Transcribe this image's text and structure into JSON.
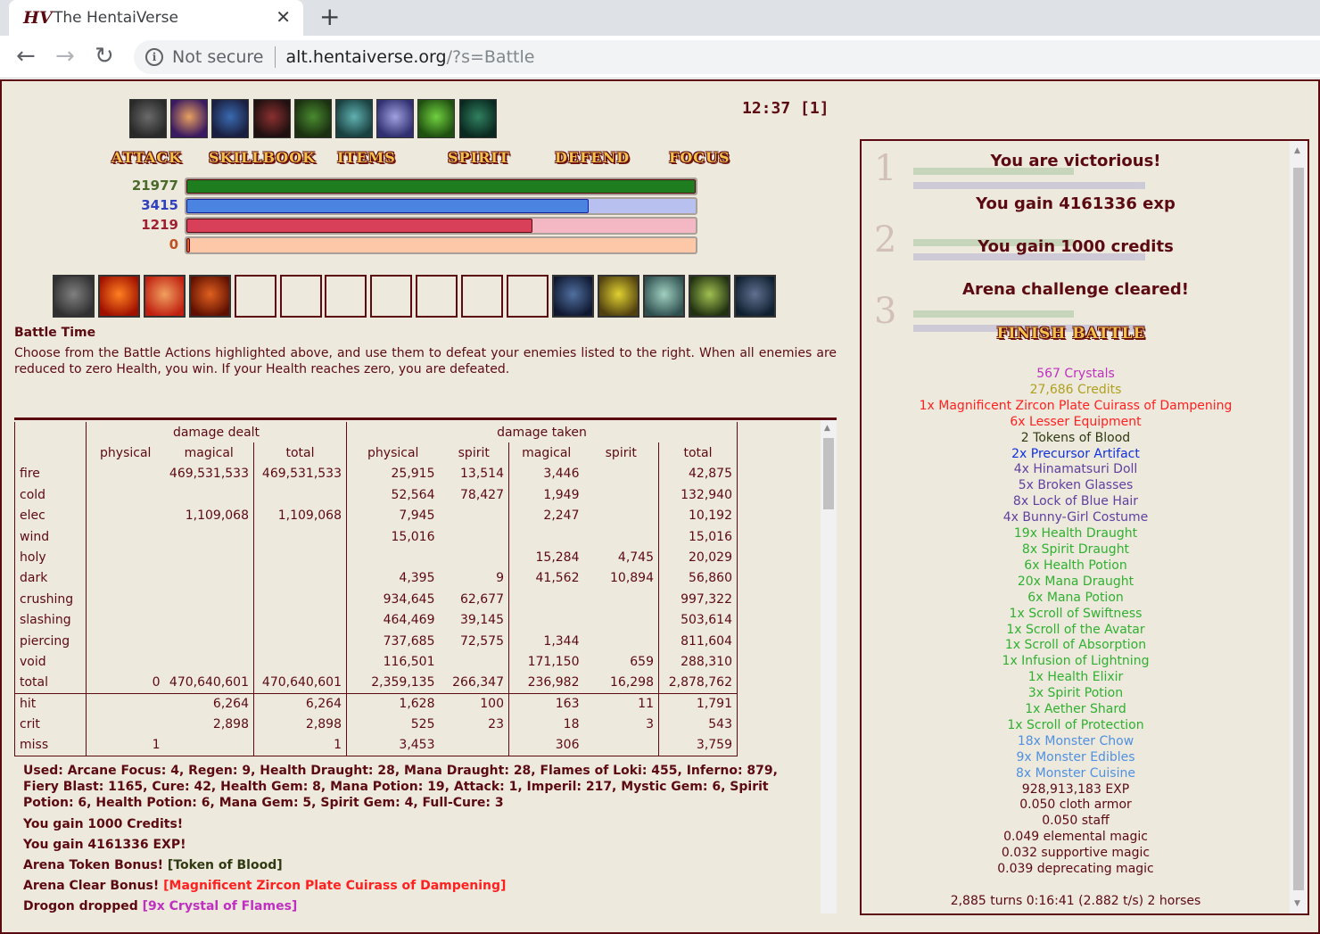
{
  "browser": {
    "tab_title": "The HentaiVerse",
    "favicon_text": "HV",
    "not_secure": "Not secure",
    "url_host": "alt.hentaiverse.org",
    "url_path": "/?s=Battle"
  },
  "timer": "12:37 [1]",
  "menu": {
    "attack": "ATTACK",
    "skillbook": "SKILLBOOK",
    "items": "ITEMS",
    "spirit": "SPIRIT",
    "defend": "DEFEND",
    "focus": "FOCUS"
  },
  "vitals": {
    "health": {
      "value": "21977",
      "fill": 1.0,
      "color": "#1e7d1e"
    },
    "magic": {
      "value": "3415",
      "fill": 0.79,
      "color": "#4a84e0"
    },
    "spirit": {
      "value": "1219",
      "fill": 0.68,
      "color": "#d8405a"
    },
    "overcharge": {
      "value": "0",
      "fill": 0.0,
      "color": "#e06030"
    }
  },
  "battle": {
    "title": "Battle Time",
    "description": "Choose from the Battle Actions highlighted above, and use them to defeat your enemies listed to the right. When all enemies are reduced to zero Health, you win. If your Health reaches zero, you are defeated."
  },
  "stats": {
    "group_dealt": "damage dealt",
    "group_taken": "damage taken",
    "columns": [
      "physical",
      "magical",
      "total",
      "physical",
      "spirit",
      "magical",
      "spirit",
      "total"
    ],
    "rows": [
      {
        "label": "fire",
        "cells": [
          "",
          "469,531,533",
          "469,531,533",
          "25,915",
          "13,514",
          "3,446",
          "",
          "42,875"
        ]
      },
      {
        "label": "cold",
        "cells": [
          "",
          "",
          "",
          "52,564",
          "78,427",
          "1,949",
          "",
          "132,940"
        ]
      },
      {
        "label": "elec",
        "cells": [
          "",
          "1,109,068",
          "1,109,068",
          "7,945",
          "",
          "2,247",
          "",
          "10,192"
        ]
      },
      {
        "label": "wind",
        "cells": [
          "",
          "",
          "",
          "15,016",
          "",
          "",
          "",
          "15,016"
        ]
      },
      {
        "label": "holy",
        "cells": [
          "",
          "",
          "",
          "",
          "",
          "15,284",
          "4,745",
          "20,029"
        ]
      },
      {
        "label": "dark",
        "cells": [
          "",
          "",
          "",
          "4,395",
          "9",
          "41,562",
          "10,894",
          "56,860"
        ]
      },
      {
        "label": "crushing",
        "cells": [
          "",
          "",
          "",
          "934,645",
          "62,677",
          "",
          "",
          "997,322"
        ]
      },
      {
        "label": "slashing",
        "cells": [
          "",
          "",
          "",
          "464,469",
          "39,145",
          "",
          "",
          "503,614"
        ]
      },
      {
        "label": "piercing",
        "cells": [
          "",
          "",
          "",
          "737,685",
          "72,575",
          "1,344",
          "",
          "811,604"
        ]
      },
      {
        "label": "void",
        "cells": [
          "",
          "",
          "",
          "116,501",
          "",
          "171,150",
          "659",
          "288,310"
        ]
      },
      {
        "label": "total",
        "cells": [
          "0",
          "470,640,601",
          "470,640,601",
          "2,359,135",
          "266,347",
          "236,982",
          "16,298",
          "2,878,762"
        ]
      }
    ],
    "rows2": [
      {
        "label": "hit",
        "cells": [
          "",
          "6,264",
          "6,264",
          "1,628",
          "100",
          "163",
          "11",
          "1,791"
        ]
      },
      {
        "label": "crit",
        "cells": [
          "",
          "2,898",
          "2,898",
          "525",
          "23",
          "18",
          "3",
          "543"
        ]
      },
      {
        "label": "miss",
        "cells": [
          "1",
          "",
          "1",
          "3,453",
          "",
          "306",
          "",
          "3,759"
        ]
      }
    ]
  },
  "log": {
    "used": "Used: Arcane Focus: 4, Regen: 9, Health Draught: 28, Mana Draught: 28, Flames of Loki: 455, Inferno: 879, Fiery Blast: 1165, Cure: 42, Health Gem: 8, Mana Potion: 19, Attack: 1, Imperil: 217, Mystic Gem: 6, Spirit Potion: 6, Health Potion: 6, Mana Gem: 5, Spirit Gem: 4, Full-Cure: 3",
    "credits": "You gain 1000 Credits!",
    "exp": "You gain 4161336 EXP!",
    "token_prefix": "Arena Token Bonus! ",
    "token_item": "[Token of Blood]",
    "clear_prefix": "Arena Clear Bonus! ",
    "clear_item": "[Magnificent Zircon Plate Cuirass of Dampening]",
    "drop_prefix": "Drogon dropped ",
    "drop_item": "[9x Crystal of Flames]"
  },
  "panel": {
    "victory": "You are victorious!",
    "gain_exp": "You gain 4161336 exp",
    "gain_credits": "You gain 1000 credits",
    "arena_cleared": "Arena challenge cleared!",
    "finish": "FINISH BATTLE",
    "loot": [
      {
        "text": "567 Crystals",
        "color": "#c030c0"
      },
      {
        "text": "27,686 Credits",
        "color": "#b0a020"
      },
      {
        "text": "1x Magnificent Zircon Plate Cuirass of Dampening",
        "color": "#ff2020"
      },
      {
        "text": "6x Lesser Equipment",
        "color": "#ff2020"
      },
      {
        "text": "2 Tokens of Blood",
        "color": "#303a10"
      },
      {
        "text": "2x Precursor Artifact",
        "color": "#1030e0"
      },
      {
        "text": "4x Hinamatsuri Doll",
        "color": "#6040a0"
      },
      {
        "text": "5x Broken Glasses",
        "color": "#6040a0"
      },
      {
        "text": "8x Lock of Blue Hair",
        "color": "#6040a0"
      },
      {
        "text": "4x Bunny-Girl Costume",
        "color": "#6040a0"
      },
      {
        "text": "19x Health Draught",
        "color": "#30b030"
      },
      {
        "text": "8x Spirit Draught",
        "color": "#30b030"
      },
      {
        "text": "6x Health Potion",
        "color": "#30b030"
      },
      {
        "text": "20x Mana Draught",
        "color": "#30b030"
      },
      {
        "text": "6x Mana Potion",
        "color": "#30b030"
      },
      {
        "text": "1x Scroll of Swiftness",
        "color": "#30b030"
      },
      {
        "text": "1x Scroll of the Avatar",
        "color": "#30b030"
      },
      {
        "text": "1x Scroll of Absorption",
        "color": "#30b030"
      },
      {
        "text": "1x Infusion of Lightning",
        "color": "#30b030"
      },
      {
        "text": "1x Health Elixir",
        "color": "#30b030"
      },
      {
        "text": "3x Spirit Potion",
        "color": "#30b030"
      },
      {
        "text": "1x Aether Shard",
        "color": "#30b030"
      },
      {
        "text": "1x Scroll of Protection",
        "color": "#30b030"
      },
      {
        "text": "18x Monster Chow",
        "color": "#5090e0"
      },
      {
        "text": "9x Monster Edibles",
        "color": "#5090e0"
      },
      {
        "text": "8x Monster Cuisine",
        "color": "#5090e0"
      },
      {
        "text": "928,913,183 EXP",
        "color": "#5c0a12"
      },
      {
        "text": "0.050 cloth armor",
        "color": "#5c0a12"
      },
      {
        "text": "0.050 staff",
        "color": "#5c0a12"
      },
      {
        "text": "0.049 elemental magic",
        "color": "#5c0a12"
      },
      {
        "text": "0.032 supportive magic",
        "color": "#5c0a12"
      },
      {
        "text": "0.039 deprecating magic",
        "color": "#5c0a12"
      }
    ],
    "footer": "2,885 turns 0:16:41 (2.882 t/s) 2 horses"
  },
  "icons": {
    "skills": [
      "skill-icon-1",
      "skill-icon-2",
      "skill-icon-3",
      "skill-icon-4",
      "skill-icon-5",
      "skill-icon-6",
      "skill-icon-7",
      "skill-icon-8",
      "skill-icon-9"
    ],
    "effects": [
      "effect-icon-1",
      "effect-icon-2",
      "effect-icon-3",
      "effect-icon-4",
      "",
      "",
      "",
      "",
      "",
      "",
      "",
      "effect-icon-12",
      "effect-icon-13",
      "effect-icon-14",
      "effect-icon-15",
      "effect-icon-16"
    ]
  }
}
